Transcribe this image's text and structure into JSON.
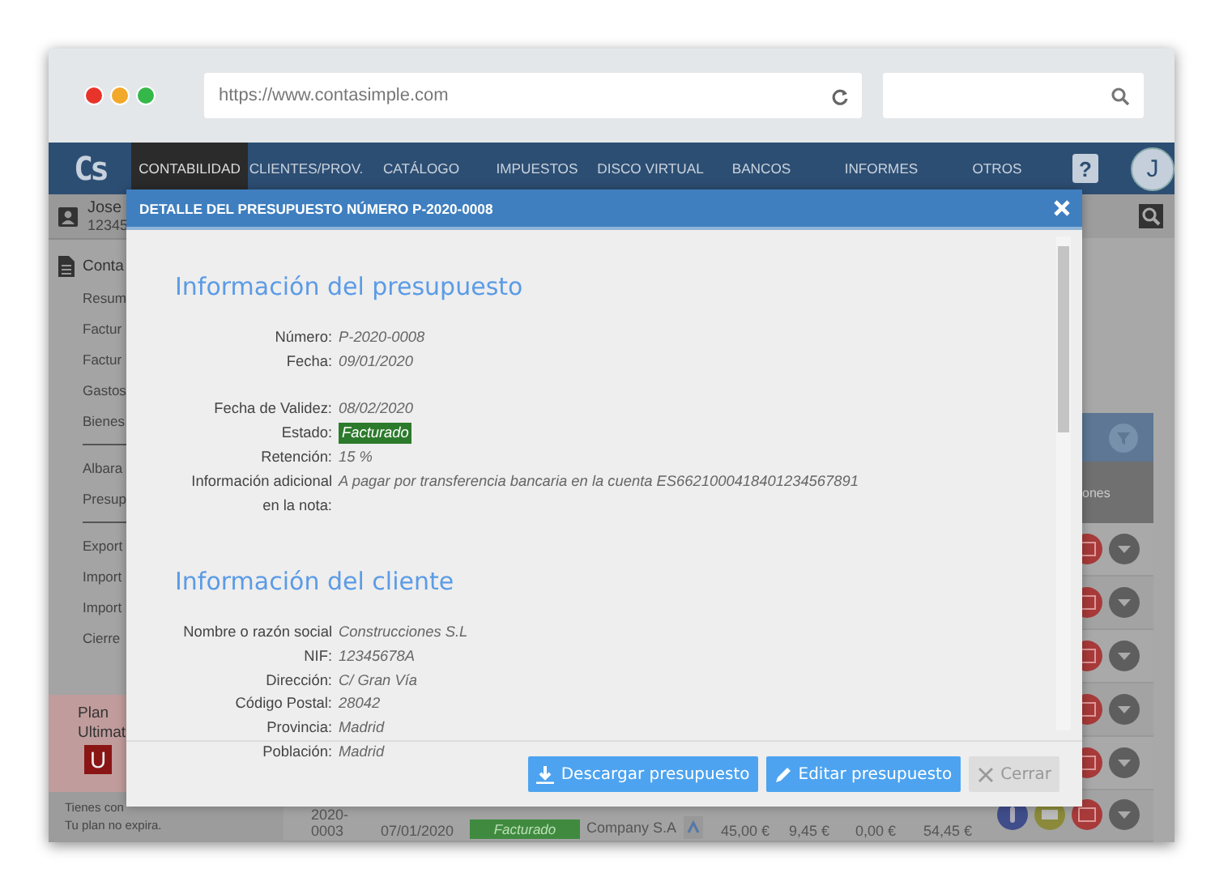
{
  "browser": {
    "url": "https://www.contasimple.com"
  },
  "nav": {
    "logo": "Cs",
    "items": [
      {
        "label": "CONTABILIDAD",
        "selected": true
      },
      {
        "label": "CLIENTES/PROV.",
        "selected": false
      },
      {
        "label": "CATÁLOGO",
        "selected": false
      },
      {
        "label": "IMPUESTOS",
        "selected": false
      },
      {
        "label": "DISCO VIRTUAL",
        "selected": false
      },
      {
        "label": "BANCOS",
        "selected": false
      },
      {
        "label": "INFORMES",
        "selected": false
      },
      {
        "label": "OTROS",
        "selected": false
      }
    ],
    "help": "?",
    "avatar": "J"
  },
  "sidebar": {
    "user_name": "Jose",
    "user_id": "12345",
    "section": "Conta",
    "item_groups": [
      [
        "Resum",
        "Factur",
        "Factur",
        "Gastos",
        "Bienes"
      ],
      [
        "Albara",
        "Presup"
      ],
      [
        "Export",
        "Import",
        "Import",
        "Cierre"
      ]
    ],
    "plan": {
      "title": "Plan",
      "name": "Ultimat",
      "badge": "U"
    },
    "notice": [
      "Tienes con",
      "Tu plan no expira."
    ]
  },
  "table": {
    "last_header": "ones",
    "row": {
      "number": "2020-\n0003",
      "date": "07/01/2020",
      "status": "Facturado",
      "client": "Company S.A",
      "base": "45,00 €",
      "iva": "9,45 €",
      "retention": "0,00 €",
      "total": "54,45 €"
    }
  },
  "modal": {
    "title": "DETALLE DEL PRESUPUESTO NÚMERO P-2020-0008",
    "sections": [
      {
        "heading": "Información del presupuesto",
        "fields": [
          {
            "label": "Número:",
            "value": "P-2020-0008",
            "kind": "text"
          },
          {
            "label": "Fecha:",
            "value": "09/01/2020",
            "kind": "text"
          },
          {
            "kind": "spacer"
          },
          {
            "label": "Fecha de Validez:",
            "value": "08/02/2020",
            "kind": "text"
          },
          {
            "label": "Estado:",
            "value": "Facturado",
            "kind": "badge"
          },
          {
            "label": "Retención:",
            "value": "15 %",
            "kind": "text"
          },
          {
            "label": "Información adicional en la nota:",
            "value": "A pagar por transferencia bancaria en la cuenta ES6621000418401234567891",
            "kind": "text"
          }
        ]
      },
      {
        "heading": "Información del cliente",
        "fields": [
          {
            "label": "Nombre o razón social",
            "value": "Construcciones S.L",
            "kind": "text"
          },
          {
            "label": "NIF:",
            "value": "12345678A",
            "kind": "text"
          },
          {
            "label": "Dirección:",
            "value": "C/ Gran Vía",
            "kind": "text"
          },
          {
            "label": "Código Postal:",
            "value": "28042",
            "kind": "text"
          },
          {
            "label": "Provincia:",
            "value": "Madrid",
            "kind": "text"
          },
          {
            "label": "Población:",
            "value": "Madrid",
            "kind": "text"
          }
        ]
      }
    ],
    "buttons": [
      {
        "label": "Descargar presupuesto",
        "kind": "download",
        "disabled": false
      },
      {
        "label": "Editar presupuesto",
        "kind": "edit",
        "disabled": false
      },
      {
        "label": "Cerrar",
        "kind": "close",
        "disabled": true
      }
    ]
  }
}
